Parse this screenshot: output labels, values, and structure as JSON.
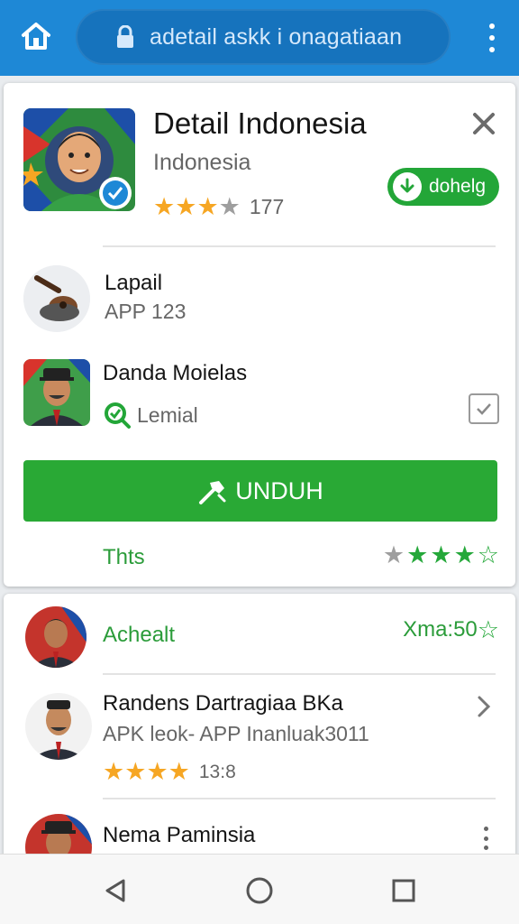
{
  "browser": {
    "url": "adetail askk i onagatiaan",
    "home_icon": "home-icon",
    "lock_icon": "lock-icon",
    "menu_icon": "more-vert-icon"
  },
  "hero": {
    "title": "Detail Indonesia",
    "subtitle": "Indonesia",
    "rating": 3,
    "rating_count": "177",
    "download_label": "dohelg",
    "close_icon": "close-icon"
  },
  "related": [
    {
      "title": "Lapail",
      "subtitle": "APP 123",
      "icon": "guitar-icon"
    },
    {
      "title": "Danda Moielas",
      "subtitle": "Lemial",
      "icon": "search-icon"
    }
  ],
  "unduh_label": "UNDUH",
  "footer": {
    "left": "Thts",
    "rating": 3
  },
  "list": [
    {
      "title": "Achealt",
      "right": "Xma:50"
    },
    {
      "title": "Randens Dartragiaa BKa",
      "subtitle": "APK leok- APP Inanluak3011",
      "rating": 4,
      "rating_count": "13:8"
    },
    {
      "title": "Nema Paminsia"
    }
  ],
  "colors": {
    "topbar": "#1e88d6",
    "accent_green": "#29a935",
    "star_orange": "#f6a623"
  }
}
